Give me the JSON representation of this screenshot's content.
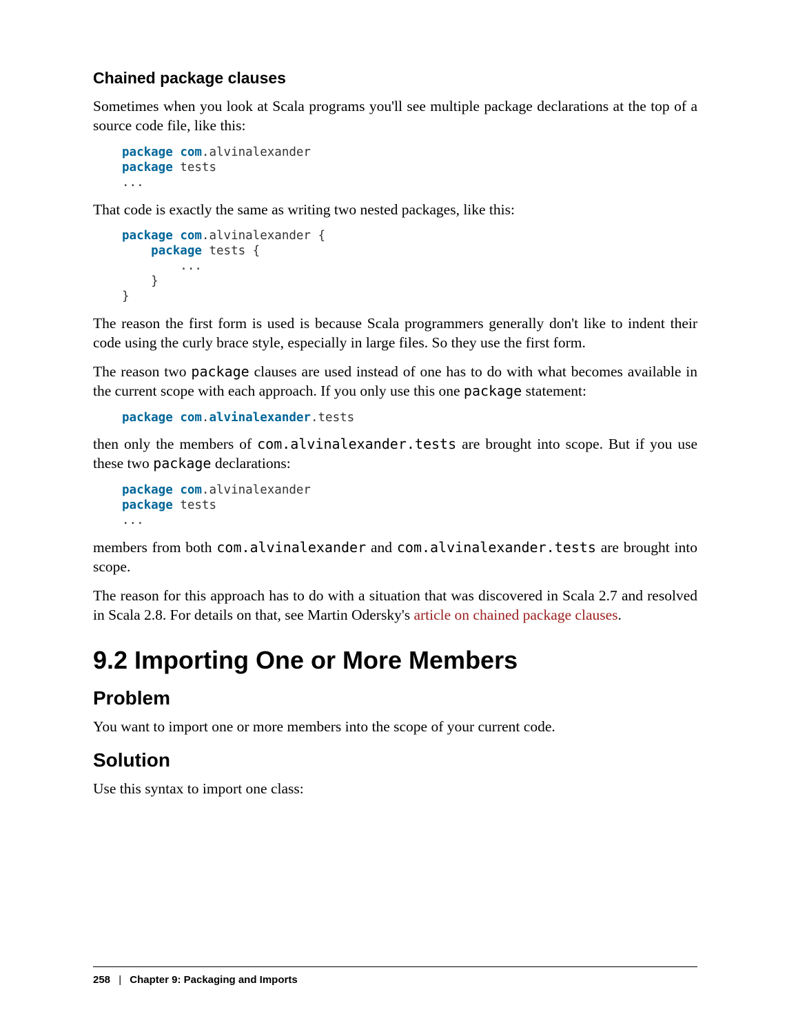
{
  "headings": {
    "chained": "Chained package clauses",
    "section": "9.2 Importing One or More Members",
    "problem": "Problem",
    "solution": "Solution"
  },
  "paragraphs": {
    "p1": "Sometimes when you look at Scala programs you'll see multiple package declarations at the top of a source code file, like this:",
    "p2": "That code is exactly the same as writing two nested packages, like this:",
    "p3": "The reason the first form is used is because Scala programmers generally don't like to indent their code using the curly brace style, especially in large files. So they use the first form.",
    "p4_a": "The reason two ",
    "p4_b": " clauses are used instead of one has to do with what becomes available in the current scope with each approach. If you only use this one ",
    "p4_c": " statement:",
    "p4_code1": "package",
    "p4_code2": "package",
    "p5_a": "then only the members of ",
    "p5_code": "com.alvinalexander.tests",
    "p5_b": " are brought into scope. But if you use these two ",
    "p5_code2": "package",
    "p5_c": " declarations:",
    "p6_a": "members from both ",
    "p6_code1": "com.alvinalexander",
    "p6_b": " and ",
    "p6_code2": "com.alvinalexander.tests",
    "p6_c": " are brought into scope.",
    "p7_a": "The reason for this approach has to do with a situation that was discovered in Scala 2.7 and resolved in Scala 2.8. For details on that, see Martin Odersky's ",
    "p7_link": "article on chained package clauses",
    "p7_b": ".",
    "problem_p": "You want to import one or more members into the scope of your current code.",
    "solution_p": "Use this syntax to import one class:"
  },
  "code": {
    "c1_kw1": "package",
    "c1_pkg1": "com",
    "c1_rest1": ".alvinalexander",
    "c1_kw2": "package",
    "c1_rest2": " tests",
    "c1_dots": "...",
    "c2_kw1": "package",
    "c2_pkg1": "com",
    "c2_rest1": ".alvinalexander {",
    "c2_kw2": "package",
    "c2_rest2": " tests {",
    "c2_dots": "        ...",
    "c2_close1": "    }",
    "c2_close0": "}",
    "c3_kw": "package",
    "c3_pkg1": "com",
    "c3_dot1": ".",
    "c3_pkg2": "alvinalexander",
    "c3_rest": ".tests",
    "c4_kw1": "package",
    "c4_pkg1": "com",
    "c4_rest1": ".alvinalexander",
    "c4_kw2": "package",
    "c4_rest2": " tests",
    "c4_dots": "..."
  },
  "footer": {
    "pagenum": "258",
    "sep": "|",
    "chapter": "Chapter 9: Packaging and Imports"
  }
}
